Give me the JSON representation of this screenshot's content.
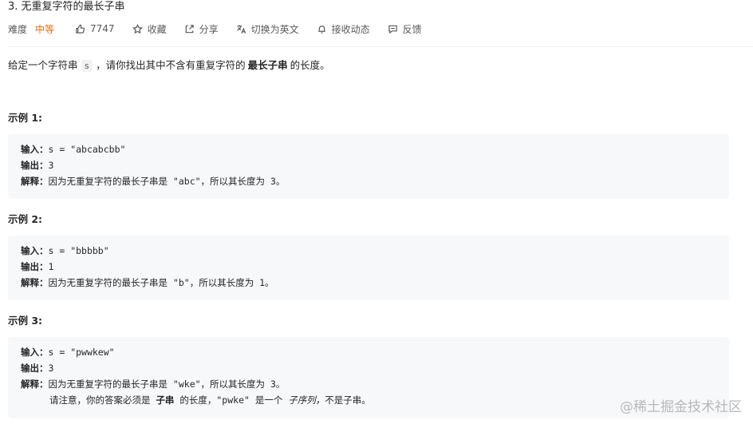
{
  "problem": {
    "title": "3. 无重复字符的最长子串",
    "difficulty_label": "难度",
    "difficulty": "中等",
    "likes": "7747",
    "favorite_label": "收藏",
    "share_label": "分享",
    "switch_lang_label": "切换为英文",
    "notify_label": "接收动态",
    "feedback_label": "反馈"
  },
  "description": {
    "part1": "给定一个字符串",
    "code": "s",
    "part2": "，请你找出其中不含有重复字符的",
    "bold": "最长子串",
    "part3": "的长度。"
  },
  "examples": [
    {
      "title": "示例 1:",
      "input_label": "输入：",
      "input": "s = \"abcabcbb\"",
      "output_label": "输出：",
      "output": "3",
      "explain_label": "解释：",
      "explain": "因为无重复字符的最长子串是 \"abc\"，所以其长度为 3。"
    },
    {
      "title": "示例 2:",
      "input_label": "输入：",
      "input": "s = \"bbbbb\"",
      "output_label": "输出：",
      "output": "1",
      "explain_label": "解释：",
      "explain": "因为无重复字符的最长子串是 \"b\"，所以其长度为 1。"
    },
    {
      "title": "示例 3:",
      "input_label": "输入：",
      "input": "s = \"pwwkew\"",
      "output_label": "输出：",
      "output": "3",
      "explain_label": "解释：",
      "explain": "因为无重复字符的最长子串是 \"wke\"，所以其长度为 3。",
      "note_prefix": "请注意，你的答案必须是",
      "note_bold": "子串",
      "note_mid": "的长度，\"pwke\" 是一个",
      "note_italic": "子序列，",
      "note_suffix": "不是子串。"
    }
  ],
  "watermark": "@稀土掘金技术社区",
  "colors": {
    "difficulty_medium": "#ef6c00",
    "example_bg": "#f7f8fa"
  },
  "icons": [
    "thumbs-up-icon",
    "star-icon",
    "share-icon",
    "translate-icon",
    "bell-icon",
    "feedback-icon"
  ]
}
